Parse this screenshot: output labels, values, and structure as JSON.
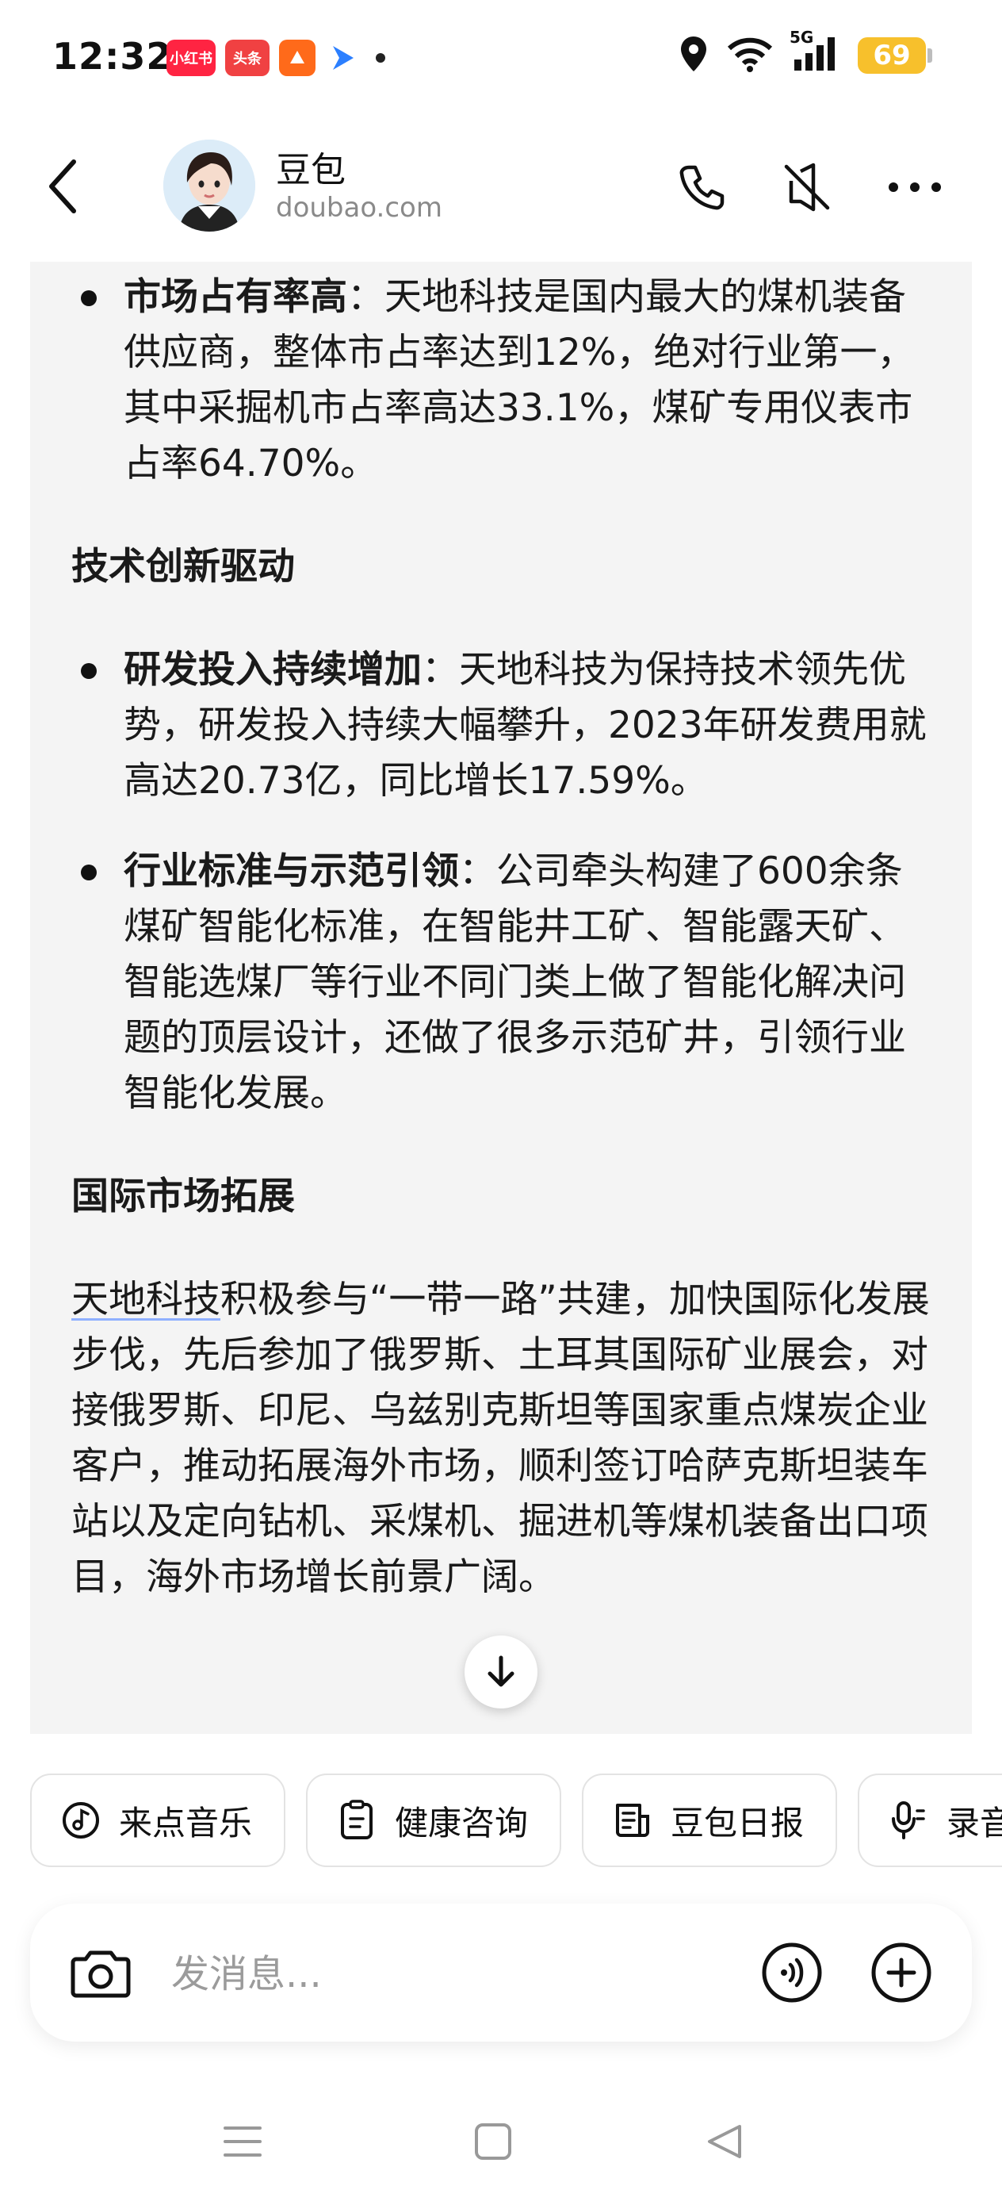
{
  "status_bar": {
    "time": "12:32",
    "apps": [
      {
        "label": "小红书",
        "color": "#ff2442"
      },
      {
        "label": "头条",
        "color": "#f04142"
      },
      {
        "label": "",
        "color": "#ff6a1a"
      },
      {
        "label": "",
        "color": "#2b7fff"
      }
    ],
    "network": "5G",
    "battery": "69"
  },
  "header": {
    "name": "豆包",
    "subtitle": "doubao.com"
  },
  "message": {
    "bullet1": {
      "bold": "市场占有率高",
      "text": "：天地科技是国内最大的煤机装备供应商，整体市占率达到12%，绝对行业第一，其中采掘机市占率高达33.1%，煤矿专用仪表市占率64.70%。"
    },
    "section2_title": "技术创新驱动",
    "bullet2": {
      "bold": "研发投入持续增加",
      "text": "：天地科技为保持技术领先优势，研发投入持续大幅攀升，2023年研发费用就高达20.73亿，同比增长17.59%。"
    },
    "bullet3": {
      "bold": "行业标准与示范引领",
      "text": "：公司牵头构建了600余条煤矿智能化标准，在智能井工矿、智能露天矿、智能选煤厂等行业不同门类上做了智能化解决问题的顶层设计，还做了很多示范矿井，引领行业智能化发展。"
    },
    "section3_title": "国际市场拓展",
    "para_link": "天地科技",
    "para_text": "积极参与“一带一路”共建，加快国际化发展步伐，先后参加了俄罗斯、土耳其国际矿业展会，对接俄罗斯、印尼、乌兹别克斯坦等国家重点煤炭企业客户，推动拓展海外市场，顺利签订哈萨克斯坦装车站以及定向钻机、采煤机、掘进机等煤机装备出口项目，海外市场增长前景广阔。"
  },
  "chips": [
    "来点音乐",
    "健康咨询",
    "豆包日报",
    "录音"
  ],
  "input": {
    "placeholder": "发消息..."
  }
}
